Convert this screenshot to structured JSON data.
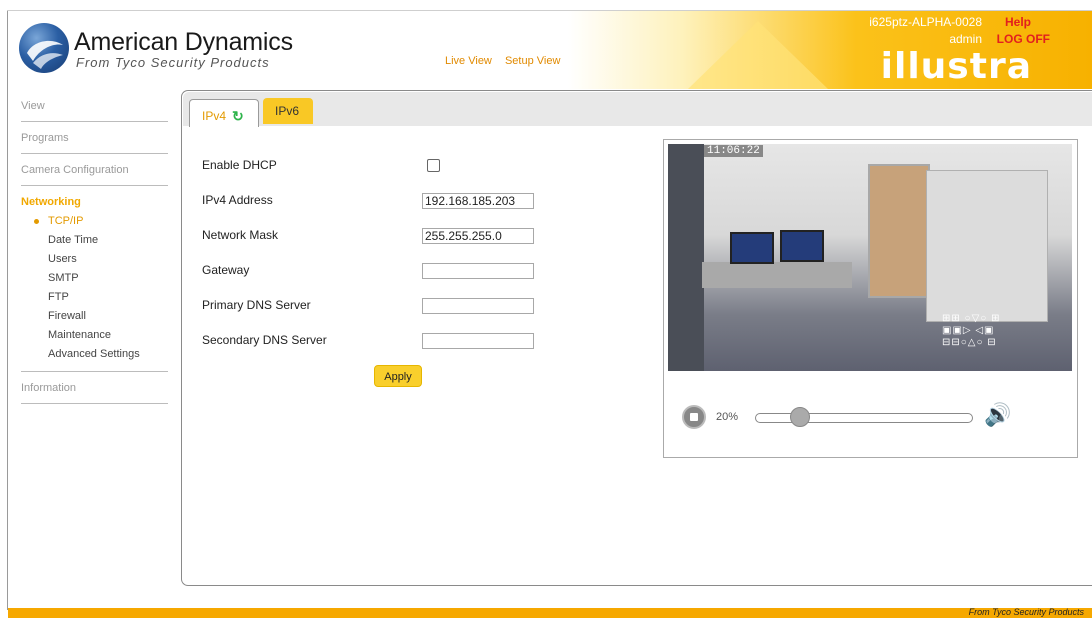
{
  "header": {
    "brand_title": "American Dynamics",
    "brand_subtitle": "From Tyco Security Products",
    "nav": {
      "live_view": "Live View",
      "setup_view": "Setup View"
    },
    "device_id": "i625ptz-ALPHA-0028",
    "user": "admin",
    "help": "Help",
    "logoff": "LOG OFF",
    "product_logo": "illustra"
  },
  "sidebar": {
    "items": [
      {
        "label": "View"
      },
      {
        "label": "Programs"
      },
      {
        "label": "Camera Configuration"
      }
    ],
    "active_section": "Networking",
    "sub_items": [
      {
        "label": "TCP/IP",
        "current": true
      },
      {
        "label": "Date Time"
      },
      {
        "label": "Users"
      },
      {
        "label": "SMTP"
      },
      {
        "label": "FTP"
      },
      {
        "label": "Firewall"
      },
      {
        "label": "Maintenance"
      },
      {
        "label": "Advanced Settings"
      }
    ],
    "after_items": [
      {
        "label": "Information"
      }
    ]
  },
  "tabs": {
    "ipv4": "IPv4",
    "ipv6": "IPv6"
  },
  "form": {
    "enable_dhcp_label": "Enable DHCP",
    "enable_dhcp_checked": false,
    "ipv4_address_label": "IPv4 Address",
    "ipv4_address_value": "192.168.185.203",
    "network_mask_label": "Network Mask",
    "network_mask_value": "255.255.255.0",
    "gateway_label": "Gateway",
    "gateway_value": "",
    "primary_dns_label": "Primary DNS Server",
    "primary_dns_value": "",
    "secondary_dns_label": "Secondary DNS Server",
    "secondary_dns_value": "",
    "apply_label": "Apply"
  },
  "video": {
    "timestamp": "11:06:22",
    "volume_percent": "20%",
    "volume_value": 0.2
  },
  "footer": {
    "text": "From Tyco Security Products"
  },
  "colors": {
    "accent": "#f6a800",
    "active_nav": "#e39a00",
    "alert": "#e2201e"
  }
}
